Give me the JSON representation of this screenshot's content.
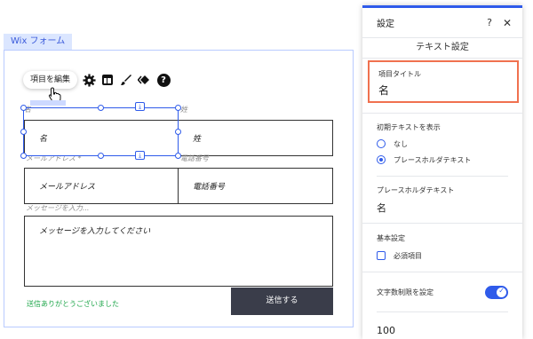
{
  "form": {
    "tag": "Wix フォーム",
    "toolbar": {
      "edit_label": "項目を編集",
      "icons": [
        "settings-gear-icon",
        "layout-icon",
        "design-brush-icon",
        "animation-icon",
        "help-icon"
      ],
      "help_glyph": "?"
    },
    "labels": {
      "first_name": "名",
      "last_name": "姓",
      "email": "メールアドレス *",
      "phone": "電話番号",
      "message": "メッセージを入力..."
    },
    "fields": {
      "first_name": "名",
      "last_name": "姓",
      "email": "メールアドレス",
      "phone": "電話番号",
      "message": "メッセージを入力してください"
    },
    "success_message": "送信ありがとうございました",
    "submit_label": "送信する",
    "colors": {
      "selection": "#2f5bea",
      "success": "#1ea64a",
      "submit_bg": "#3a3d4a"
    }
  },
  "panel": {
    "title": "設定",
    "help": "?",
    "close": "✕",
    "subtitle": "テキスト設定",
    "field_title": {
      "label": "項目タイトル",
      "value": "名"
    },
    "initial_text": {
      "label": "初期テキストを表示",
      "options": [
        {
          "label": "なし",
          "selected": false
        },
        {
          "label": "プレースホルダテキスト",
          "selected": true
        }
      ]
    },
    "placeholder": {
      "label": "プレースホルダテキスト",
      "value": "名"
    },
    "basic": {
      "label": "基本設定",
      "required_label": "必須項目",
      "required_checked": false
    },
    "char_limit": {
      "label": "文字数制限を設定",
      "enabled": true
    },
    "limit_value": "100",
    "colors": {
      "accent": "#2f5bea",
      "highlight": "#f0714f"
    }
  }
}
